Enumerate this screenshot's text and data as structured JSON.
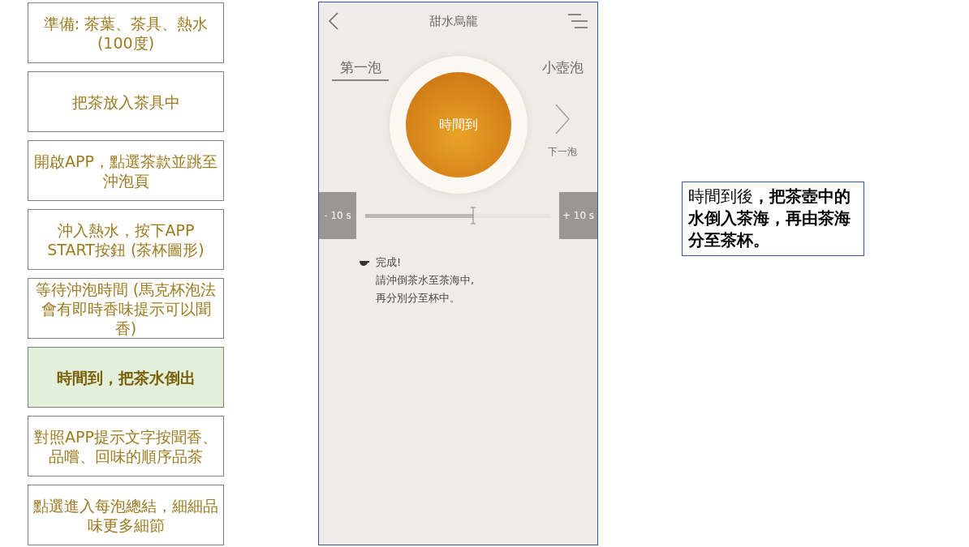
{
  "steps": [
    {
      "text": "準備: 茶葉、茶具、熱水 (100度)",
      "selected": false
    },
    {
      "text": "把茶放入茶具中",
      "selected": false
    },
    {
      "text": "開啟APP，點選茶款並跳至沖泡頁",
      "selected": false
    },
    {
      "text": "沖入熱水，按下APP START按鈕 (茶杯圖形)",
      "selected": false
    },
    {
      "text": "等待沖泡時間 (馬克杯泡法會有即時香味提示可以聞香)",
      "selected": false
    },
    {
      "text": "時間到，把茶水倒出",
      "selected": true
    },
    {
      "text": "對照APP提示文字按聞香、品嚐、回味的順序品茶",
      "selected": false
    },
    {
      "text": "點選進入每泡總結，細細品味更多細節",
      "selected": false
    }
  ],
  "phone": {
    "title": "甜水烏龍",
    "tabs": [
      {
        "label": "第一泡",
        "selected": true
      },
      {
        "label": "小壺泡",
        "selected": false
      }
    ],
    "cup_label": "時間到",
    "next_label": "下一泡",
    "minus_button": "- 10 s",
    "plus_button": "+ 10 s",
    "timer": {
      "level": 0.585
    },
    "message": [
      "完成!",
      "請沖倒茶水至茶海中,",
      "再分別分至杯中。"
    ]
  },
  "callout": "時間到後**，把茶壺中的水倒入茶海，再由茶海分至茶杯。**"
}
